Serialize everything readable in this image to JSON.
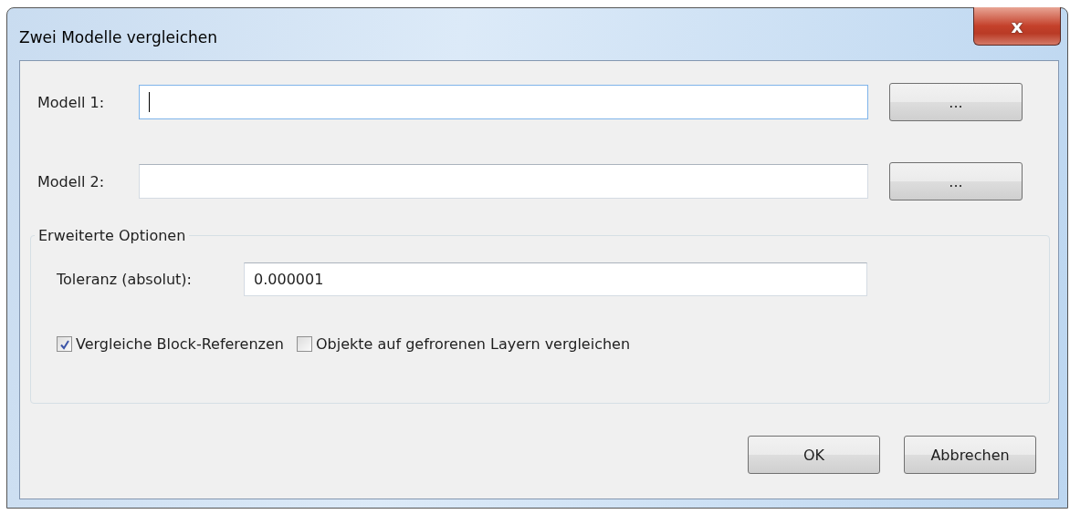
{
  "window": {
    "title": "Zwei Modelle vergleichen",
    "close_button": "x"
  },
  "models": [
    {
      "label": "Modell 1:",
      "focused": true,
      "browse": "..."
    },
    {
      "label": "Modell 2:",
      "focused": false,
      "browse": "..."
    }
  ],
  "advanced": {
    "legend": "Erweiterte Optionen",
    "tolerance_label": "Toleranz (absolut):",
    "tolerance_value": "0.000001",
    "checkboxes": [
      {
        "label": "Vergleiche Block-Referenzen",
        "checked": true
      },
      {
        "label": "Objekte auf gefrorenen Layern vergleichen",
        "checked": false
      }
    ]
  },
  "buttons": [
    "OK",
    "Abbrechen"
  ]
}
